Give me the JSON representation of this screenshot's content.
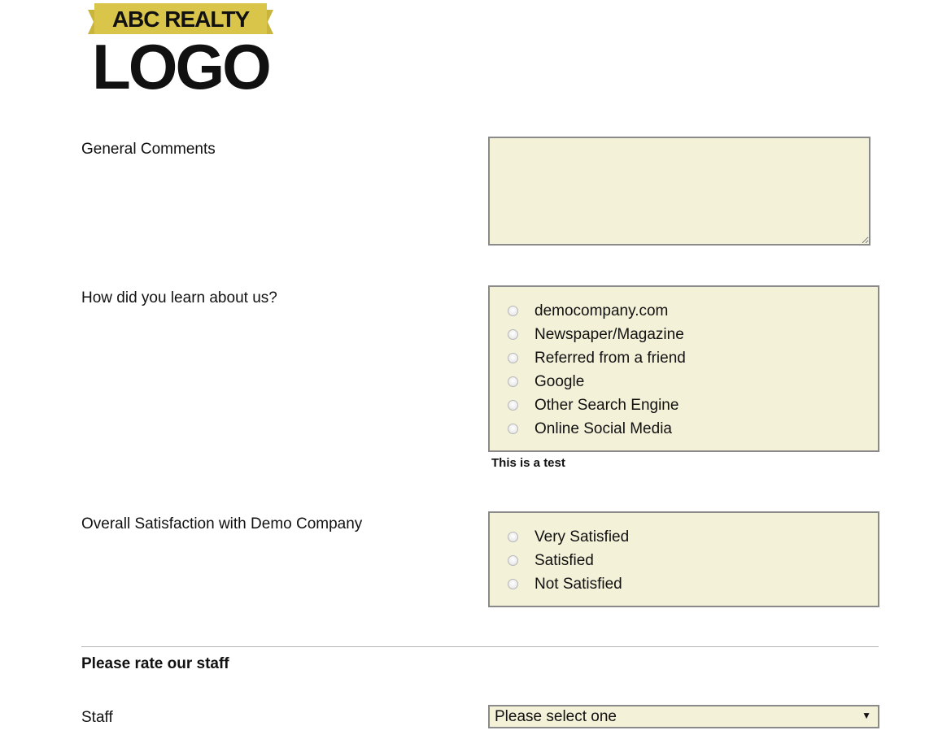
{
  "logo": {
    "banner_text": "ABC REALTY",
    "main_text": "LOGO",
    "banner_color": "#d9c54a",
    "text_color": "#111111"
  },
  "general_comments": {
    "label": "General Comments",
    "value": ""
  },
  "learn_about": {
    "label": "How did you learn about us?",
    "options": [
      "democompany.com",
      "Newspaper/Magazine",
      "Referred from a friend",
      "Google",
      "Other Search Engine",
      "Online Social Media"
    ],
    "note": "This is a test"
  },
  "satisfaction": {
    "label": "Overall Satisfaction with Demo Company",
    "options": [
      "Very Satisfied",
      "Satisfied",
      "Not Satisfied"
    ]
  },
  "staff_section": {
    "heading": "Please rate our staff",
    "staff_label": "Staff",
    "staff_select": "Please select one"
  },
  "colors": {
    "field_background": "#f4f1d9",
    "field_border": "#8a8a8a"
  }
}
